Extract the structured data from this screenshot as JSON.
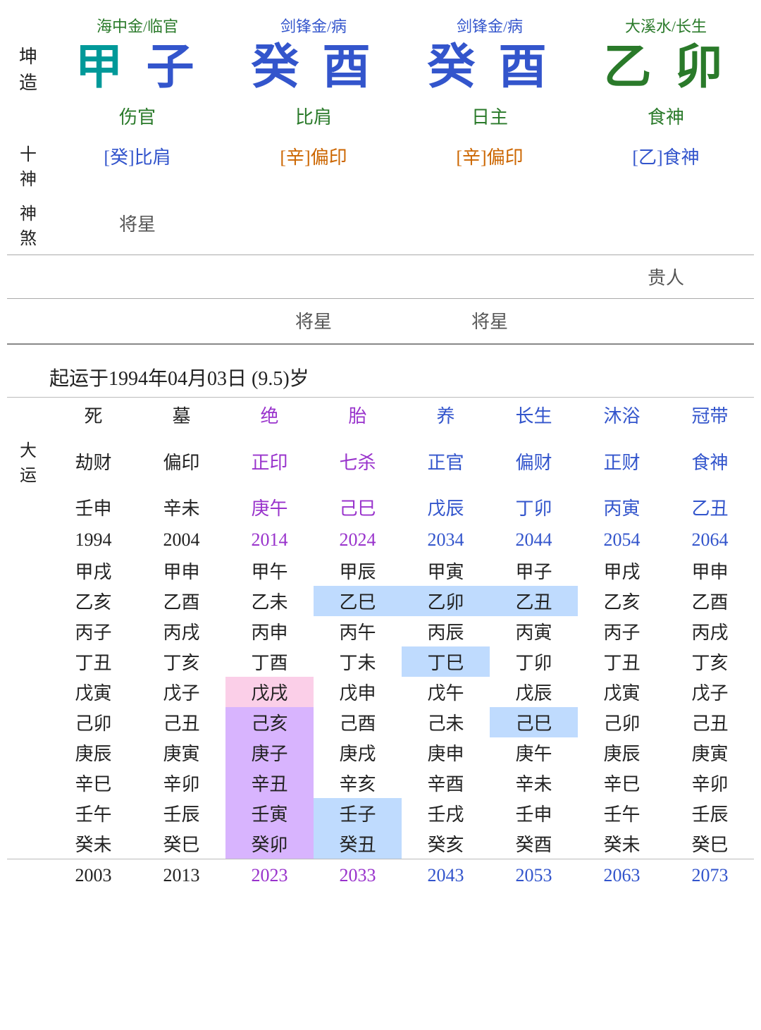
{
  "pillars": {
    "label_top": "坤\n造",
    "columns": [
      {
        "nayin": "海中金/临官",
        "ganzhi": "甲子",
        "gan": "甲",
        "zhi": "子",
        "gan_color": "teal",
        "zhi_color": "blue",
        "shishen": "伤官",
        "shishen_color": "green",
        "ten_god": "[癸]比肩",
        "ten_god_color": "blue"
      },
      {
        "nayin": "剑锋金/病",
        "ganzhi": "癸酉",
        "gan": "癸",
        "zhi": "酉",
        "gan_color": "blue",
        "zhi_color": "blue",
        "shishen": "比肩",
        "shishen_color": "green",
        "ten_god": "[辛]偏印",
        "ten_god_color": "orange"
      },
      {
        "nayin": "剑锋金/病",
        "ganzhi": "癸酉",
        "gan": "癸",
        "zhi": "酉",
        "gan_color": "blue",
        "zhi_color": "blue",
        "shishen": "日主",
        "shishen_color": "green",
        "ten_god": "[辛]偏印",
        "ten_god_color": "orange"
      },
      {
        "nayin": "大溪水/长生",
        "ganzhi": "乙卯",
        "gan": "乙",
        "zhi": "卯",
        "gan_color": "green",
        "zhi_color": "green",
        "shishen": "食神",
        "shishen_color": "green",
        "ten_god": "[乙]食神",
        "ten_god_color": "blue"
      }
    ]
  },
  "shensha": {
    "label": "神\n煞",
    "rows": [
      {
        "cells": [
          "将星",
          "",
          "",
          ""
        ]
      },
      {
        "cells": [
          "",
          "",
          "",
          "贵人"
        ]
      },
      {
        "cells": [
          "",
          "将星",
          "将星",
          ""
        ]
      }
    ]
  },
  "dayun_start": "起运于1994年04月03日 (9.5)岁",
  "dayun": {
    "header_labels": [
      "死",
      "墓",
      "绝",
      "胎",
      "养",
      "长生",
      "沐浴",
      "冠带"
    ],
    "header_colors": [
      "black",
      "black",
      "purple",
      "purple",
      "blue",
      "blue",
      "blue",
      "blue"
    ],
    "shishen": [
      "劫财",
      "偏印",
      "正印",
      "七杀",
      "正官",
      "偏财",
      "正财",
      "食神"
    ],
    "shishen_colors": [
      "black",
      "black",
      "purple",
      "purple",
      "blue",
      "blue",
      "blue",
      "blue"
    ],
    "ganzhi": [
      "壬申",
      "辛未",
      "庚午",
      "己巳",
      "戊辰",
      "丁卯",
      "丙寅",
      "乙丑"
    ],
    "ganzhi_colors": [
      "black",
      "black",
      "purple",
      "purple",
      "blue",
      "blue",
      "blue",
      "blue"
    ],
    "years": [
      "1994",
      "2004",
      "2014",
      "2024",
      "2034",
      "2044",
      "2054",
      "2064"
    ],
    "years_colors": [
      "black",
      "black",
      "purple",
      "purple",
      "blue",
      "blue",
      "blue",
      "blue"
    ]
  },
  "yearly_rows": [
    {
      "label": "",
      "cells": [
        "甲戌",
        "甲申",
        "甲午",
        "甲辰",
        "甲寅",
        "甲子",
        "甲戌",
        "甲申"
      ],
      "highlights": [
        false,
        false,
        false,
        false,
        false,
        false,
        false,
        false
      ]
    },
    {
      "label": "",
      "cells": [
        "乙亥",
        "乙酉",
        "乙未",
        "乙巳",
        "乙卯",
        "乙丑",
        "乙亥",
        "乙酉"
      ],
      "highlights": [
        false,
        false,
        false,
        true,
        true,
        true,
        false,
        false
      ]
    },
    {
      "label": "",
      "cells": [
        "丙子",
        "丙戌",
        "丙申",
        "丙午",
        "丙辰",
        "丙寅",
        "丙子",
        "丙戌"
      ],
      "highlights": [
        false,
        false,
        false,
        false,
        false,
        false,
        false,
        false
      ]
    },
    {
      "label": "",
      "cells": [
        "丁丑",
        "丁亥",
        "丁酉",
        "丁未",
        "丁巳",
        "丁卯",
        "丁丑",
        "丁亥"
      ],
      "highlights": [
        false,
        false,
        false,
        false,
        true,
        false,
        false,
        false
      ]
    },
    {
      "label": "",
      "cells": [
        "戊寅",
        "戊子",
        "戊戌",
        "戊申",
        "戊午",
        "戊辰",
        "戊寅",
        "戊子"
      ],
      "highlights": [
        false,
        false,
        true,
        false,
        false,
        false,
        false,
        false
      ],
      "highlight_types": [
        null,
        null,
        "pink",
        null,
        null,
        null,
        null,
        null
      ]
    },
    {
      "label": "",
      "cells": [
        "己卯",
        "己丑",
        "己亥",
        "己酉",
        "己未",
        "己巳",
        "己卯",
        "己丑"
      ],
      "highlights": [
        false,
        false,
        true,
        false,
        false,
        true,
        false,
        false
      ],
      "highlight_types": [
        null,
        null,
        "purple",
        null,
        null,
        "blue",
        null,
        null
      ]
    },
    {
      "label": "",
      "cells": [
        "庚辰",
        "庚寅",
        "庚子",
        "庚戌",
        "庚申",
        "庚午",
        "庚辰",
        "庚寅"
      ],
      "highlights": [
        false,
        false,
        true,
        false,
        false,
        false,
        false,
        false
      ],
      "highlight_types": [
        null,
        null,
        "purple",
        null,
        null,
        null,
        null,
        null
      ]
    },
    {
      "label": "",
      "cells": [
        "辛巳",
        "辛卯",
        "辛丑",
        "辛亥",
        "辛酉",
        "辛未",
        "辛巳",
        "辛卯"
      ],
      "highlights": [
        false,
        false,
        true,
        false,
        false,
        false,
        false,
        false
      ],
      "highlight_types": [
        null,
        null,
        "purple",
        null,
        null,
        null,
        null,
        null
      ]
    },
    {
      "label": "",
      "cells": [
        "壬午",
        "壬辰",
        "壬寅",
        "壬子",
        "壬戌",
        "壬申",
        "壬午",
        "壬辰"
      ],
      "highlights": [
        false,
        false,
        true,
        true,
        false,
        false,
        false,
        false
      ],
      "highlight_types": [
        null,
        null,
        "purple",
        "blue",
        null,
        null,
        null,
        null
      ]
    },
    {
      "label": "",
      "cells": [
        "癸未",
        "癸巳",
        "癸卯",
        "癸丑",
        "癸亥",
        "癸酉",
        "癸未",
        "癸巳"
      ],
      "highlights": [
        false,
        false,
        true,
        true,
        false,
        false,
        false,
        false
      ],
      "highlight_types": [
        null,
        null,
        "purple",
        "blue",
        null,
        null,
        null,
        null
      ]
    }
  ],
  "bottom_years": [
    "2003",
    "2013",
    "2023",
    "2033",
    "2043",
    "2053",
    "2063",
    "2073"
  ],
  "bottom_years_colors": [
    "black",
    "black",
    "purple",
    "purple",
    "blue",
    "blue",
    "blue",
    "blue"
  ]
}
